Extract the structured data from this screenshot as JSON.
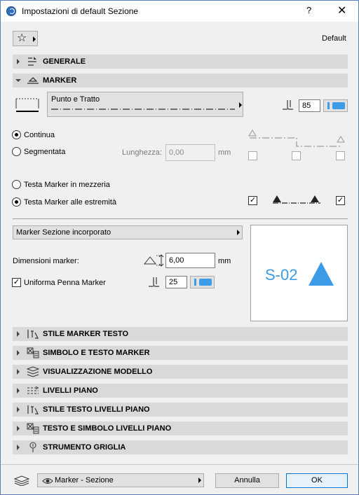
{
  "window": {
    "title": "Impostazioni di default Sezione",
    "help_label": "?",
    "close_label": "✕"
  },
  "favorites": {
    "icon": "star-icon",
    "default_label": "Default"
  },
  "sections": {
    "generale": "GENERALE",
    "marker": "MARKER",
    "stile_marker_testo": "STILE MARKER TESTO",
    "simbolo_testo_marker": "SIMBOLO E TESTO MARKER",
    "visualizzazione_modello": "VISUALIZZAZIONE MODELLO",
    "livelli_piano": "LIVELLI PIANO",
    "stile_testo_livelli": "STILE TESTO LIVELLI PIANO",
    "testo_simbolo_livelli": "TESTO E SIMBOLO LIVELLI PIANO",
    "strumento_griglia": "STRUMENTO GRIGLIA"
  },
  "marker": {
    "line_type": "Punto e Tratto",
    "pen_number": "85",
    "continua_label": "Continua",
    "segmentata_label": "Segmentata",
    "lunghezza_label": "Lunghezza:",
    "lunghezza_value": "0,00",
    "lunghezza_unit": "mm",
    "testa_mezzeria_label": "Testa Marker in mezzeria",
    "testa_estremita_label": "Testa Marker alle estremità",
    "check_mark": "✓",
    "marker_type": "Marker Sezione incorporato",
    "dimensioni_label": "Dimensioni marker:",
    "dimensioni_value": "6,00",
    "dimensioni_unit": "mm",
    "uniforma_penna_label": "Uniforma Penna Marker",
    "marker_pen": "25",
    "preview_code": "S-02",
    "accent_color": "#3e9be8"
  },
  "footer": {
    "view_label": "Marker - Sezione",
    "cancel_label": "Annulla",
    "ok_label": "OK"
  }
}
